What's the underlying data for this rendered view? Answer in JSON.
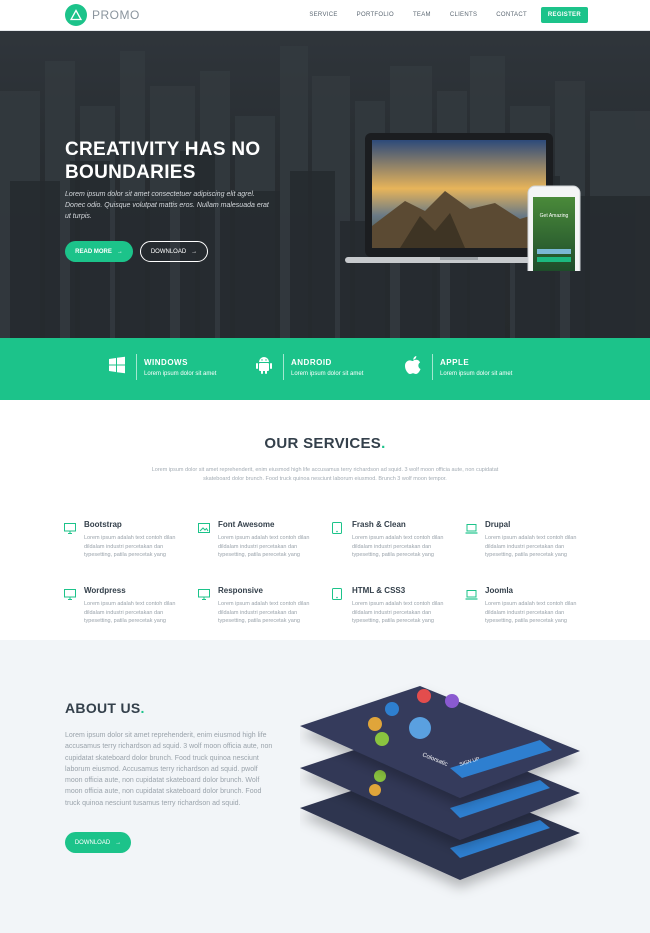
{
  "colors": {
    "accent": "#1cc38a",
    "dark": "#34404b",
    "muted": "#9aa3ab"
  },
  "nav": {
    "logo_text": "PROMO",
    "items": [
      "SERVICE",
      "PORTFOLIO",
      "TEAM",
      "CLIENTS",
      "CONTACT"
    ],
    "register_label": "REGISTER"
  },
  "hero": {
    "title": "CREATIVITY HAS NO BOUNDARIES",
    "text": "Lorem ipsum dolor sit amet consectetuer adipiscing elit agrel. Donec odio. Quisque volutpat mattis eros. Nullam malesuada erat ut turpis.",
    "read_more_label": "READ MORE",
    "download_label": "DOWNLOAD",
    "phone_caption": "Get Amazing"
  },
  "platforms": [
    {
      "icon": "windows-icon",
      "title": "WINDOWS",
      "subtitle": "Lorem ipsum dolor sit amet"
    },
    {
      "icon": "android-icon",
      "title": "ANDROID",
      "subtitle": "Lorem ipsum dolor sit amet"
    },
    {
      "icon": "apple-icon",
      "title": "APPLE",
      "subtitle": "Lorem ipsum dolor sit amet"
    }
  ],
  "services": {
    "title": "OUR SERVICES",
    "subtitle": "Lorem ipsum dolor sit amet reprehenderit, enim eiusmod high life accusamus terry richardson ad squid. 3 wolf moon officia aute, non cupidatat skateboard dolor brunch. Food truck quinoa nesciunt laborum eiusmod. Brunch 3 wolf moon tempor.",
    "items": [
      {
        "icon": "monitor-icon",
        "title": "Bootstrap",
        "text": "Lorem ipsum adalah text contoh dilan dildalam industri percetakan dan typesetting, patila perecetak yang"
      },
      {
        "icon": "image-icon",
        "title": "Font Awesome",
        "text": "Lorem ipsum adalah text contoh dilan dildalam industri percetakan dan typesetting, patila perecetak yang"
      },
      {
        "icon": "tablet-icon",
        "title": "Frash & Clean",
        "text": "Lorem ipsum adalah text contoh dilan dildalam industri percetakan dan typesetting, patila perecetak yang"
      },
      {
        "icon": "laptop-icon",
        "title": "Drupal",
        "text": "Lorem ipsum adalah text contoh dilan dildalam industri percetakan dan typesetting, patila perecetak yang"
      },
      {
        "icon": "monitor-icon",
        "title": "Wordpress",
        "text": "Lorem ipsum adalah text contoh dilan dildalam industri percetakan dan typesetting, patila perecetak yang"
      },
      {
        "icon": "monitor-icon",
        "title": "Responsive",
        "text": "Lorem ipsum adalah text contoh dilan dildalam industri percetakan dan typesetting, patila perecetak yang"
      },
      {
        "icon": "tablet-icon",
        "title": "HTML & CSS3",
        "text": "Lorem ipsum adalah text contoh dilan dildalam industri percetakan dan typesetting, patila perecetak yang"
      },
      {
        "icon": "laptop-icon",
        "title": "Joomla",
        "text": "Lorem ipsum adalah text contoh dilan dildalam industri percetakan dan typesetting, patila perecetak yang"
      }
    ]
  },
  "about": {
    "title": "ABOUT US",
    "text": "Lorem ipsum dolor sit amet reprehenderit, enim eiusmod high life accusamus terry richardson ad squid. 3 wolf moon officia aute, non cupidatat skateboard dolor brunch. Food truck quinoa nesciunt laborum eiusmod. Accusamus terry richardson ad squid. pwolf moon officia aute, non cupidatat skateboard dolor brunch. Wolf moon officia aute, non cupidatat skateboard dolor brunch. Food truck quinoa nesciunt tusamus terry richardson ad squid.",
    "download_label": "DOWNLOAD",
    "app_title": "Colorsatic",
    "app_button": "SIGN UP"
  }
}
